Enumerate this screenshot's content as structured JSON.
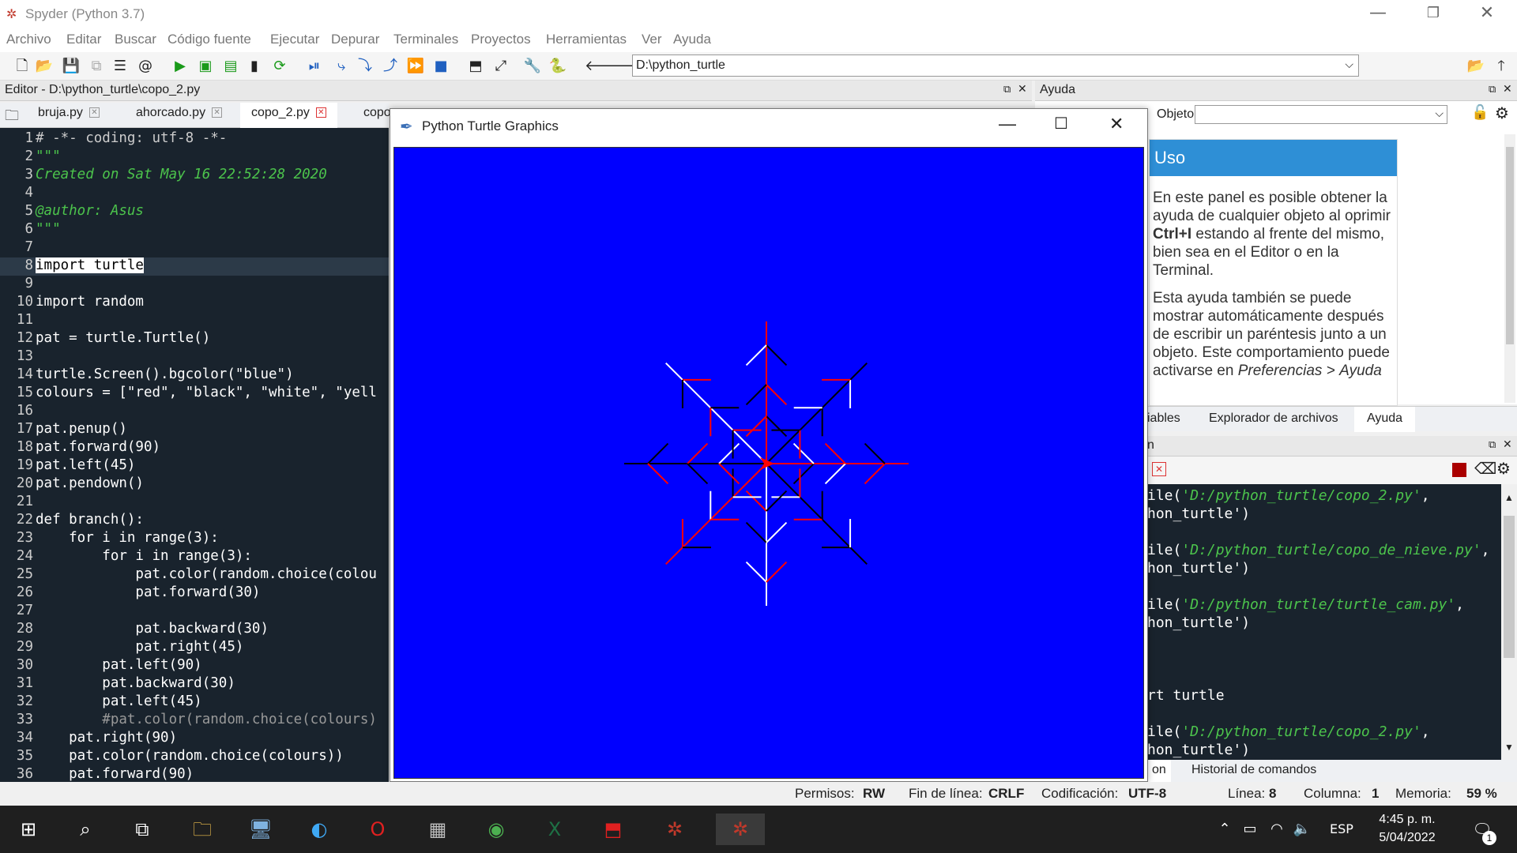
{
  "app": {
    "title": "Spyder (Python 3.7)"
  },
  "menu": [
    "Archivo",
    "Editar",
    "Buscar",
    "Código fuente",
    "Ejecutar",
    "Depurar",
    "Terminales",
    "Proyectos",
    "Herramientas",
    "Ver",
    "Ayuda"
  ],
  "toolbar": {
    "path": "D:\\python_turtle"
  },
  "editor": {
    "header": "Editor - D:\\python_turtle\\copo_2.py",
    "tabs": [
      "bruja.py",
      "ahorcado.py",
      "copo_2.py",
      "copo"
    ],
    "active_tab": "copo_2.py",
    "lines": [
      {
        "n": "1",
        "t": "# -*- coding: utf-8 -*-"
      },
      {
        "n": "2",
        "t": "\"\"\""
      },
      {
        "n": "3",
        "t": "Created on Sat May 16 22:52:28 2020"
      },
      {
        "n": "4",
        "t": ""
      },
      {
        "n": "5",
        "t": "@author: Asus"
      },
      {
        "n": "6",
        "t": "\"\"\""
      },
      {
        "n": "7",
        "t": ""
      },
      {
        "n": "8",
        "t": "import turtle"
      },
      {
        "n": "9",
        "t": ""
      },
      {
        "n": "10",
        "t": "import random"
      },
      {
        "n": "11",
        "t": ""
      },
      {
        "n": "12",
        "t": "pat = turtle.Turtle()"
      },
      {
        "n": "13",
        "t": ""
      },
      {
        "n": "14",
        "t": "turtle.Screen().bgcolor(\"blue\")"
      },
      {
        "n": "15",
        "t": "colours = [\"red\", \"black\", \"white\", \"yell"
      },
      {
        "n": "16",
        "t": ""
      },
      {
        "n": "17",
        "t": "pat.penup()"
      },
      {
        "n": "18",
        "t": "pat.forward(90)"
      },
      {
        "n": "19",
        "t": "pat.left(45)"
      },
      {
        "n": "20",
        "t": "pat.pendown()"
      },
      {
        "n": "21",
        "t": ""
      },
      {
        "n": "22",
        "t": "def branch():"
      },
      {
        "n": "23",
        "t": "    for i in range(3):"
      },
      {
        "n": "24",
        "t": "        for i in range(3):"
      },
      {
        "n": "25",
        "t": "            pat.color(random.choice(colou"
      },
      {
        "n": "26",
        "t": "            pat.forward(30)"
      },
      {
        "n": "27",
        "t": ""
      },
      {
        "n": "28",
        "t": "            pat.backward(30)"
      },
      {
        "n": "29",
        "t": "            pat.right(45)"
      },
      {
        "n": "30",
        "t": "        pat.left(90)"
      },
      {
        "n": "31",
        "t": "        pat.backward(30)"
      },
      {
        "n": "32",
        "t": "        pat.left(45)"
      },
      {
        "n": "33",
        "t": "        #pat.color(random.choice(colours)"
      },
      {
        "n": "34",
        "t": "    pat.right(90)"
      },
      {
        "n": "35",
        "t": "    pat.color(random.choice(colours))"
      },
      {
        "n": "36",
        "t": "    pat.forward(90)"
      }
    ]
  },
  "turtle_window": {
    "title": "Python Turtle Graphics",
    "bgcolor": "#0000ff"
  },
  "help": {
    "header": "Ayuda",
    "object_label": "Objeto",
    "uso_title": "Uso",
    "p1_a": "En este panel es posible obtener la ayuda de cualquier objeto al oprimir ",
    "p1_b": "Ctrl+I",
    "p1_c": " estando al frente del mismo, bien sea en el Editor o en la Terminal.",
    "p2_a": "Esta ayuda también se puede mostrar automáticamente después de escribir un paréntesis junto a un objeto. Este comportamiento puede activarse en ",
    "p2_b": "Preferencias >",
    "p2_c": "Ayuda"
  },
  "help_tabs": [
    "iables",
    "Explorador de archivos",
    "Ayuda"
  ],
  "console_header": "n",
  "console_lines": [
    {
      "a": "ile(",
      "s": "'D:/python_turtle/copo_2.py'",
      "b": ","
    },
    {
      "a": "hon_turtle')",
      "s": "",
      "b": ""
    },
    {
      "a": "",
      "s": "",
      "b": ""
    },
    {
      "a": "ile(",
      "s": "'D:/python_turtle/copo_de_nieve.py'",
      "b": ","
    },
    {
      "a": "hon_turtle')",
      "s": "",
      "b": ""
    },
    {
      "a": "",
      "s": "",
      "b": ""
    },
    {
      "a": "ile(",
      "s": "'D:/python_turtle/turtle_cam.py'",
      "b": ","
    },
    {
      "a": "hon_turtle')",
      "s": "",
      "b": ""
    },
    {
      "a": "",
      "s": "",
      "b": ""
    },
    {
      "a": "",
      "s": "",
      "b": ""
    },
    {
      "a": "",
      "s": "",
      "b": ""
    },
    {
      "a": "rt turtle",
      "s": "",
      "b": ""
    },
    {
      "a": "",
      "s": "",
      "b": ""
    },
    {
      "a": "ile(",
      "s": "'D:/python_turtle/copo_2.py'",
      "b": ","
    },
    {
      "a": "hon_turtle')",
      "s": "",
      "b": ""
    }
  ],
  "console_tabs": [
    "on",
    "Historial de comandos"
  ],
  "status": {
    "permisos_label": "Permisos:",
    "permisos": "RW",
    "fin_label": "Fin de línea:",
    "fin": "CRLF",
    "cod_label": "Codificación:",
    "cod": "UTF-8",
    "linea_label": "Línea:",
    "linea": "8",
    "col_label": "Columna:",
    "col": "1",
    "mem_label": "Memoria:",
    "mem": "59 %"
  },
  "taskbar": {
    "lang": "ESP",
    "time": "4:45 p. m.",
    "date": "5/04/2022",
    "notif": "1"
  }
}
